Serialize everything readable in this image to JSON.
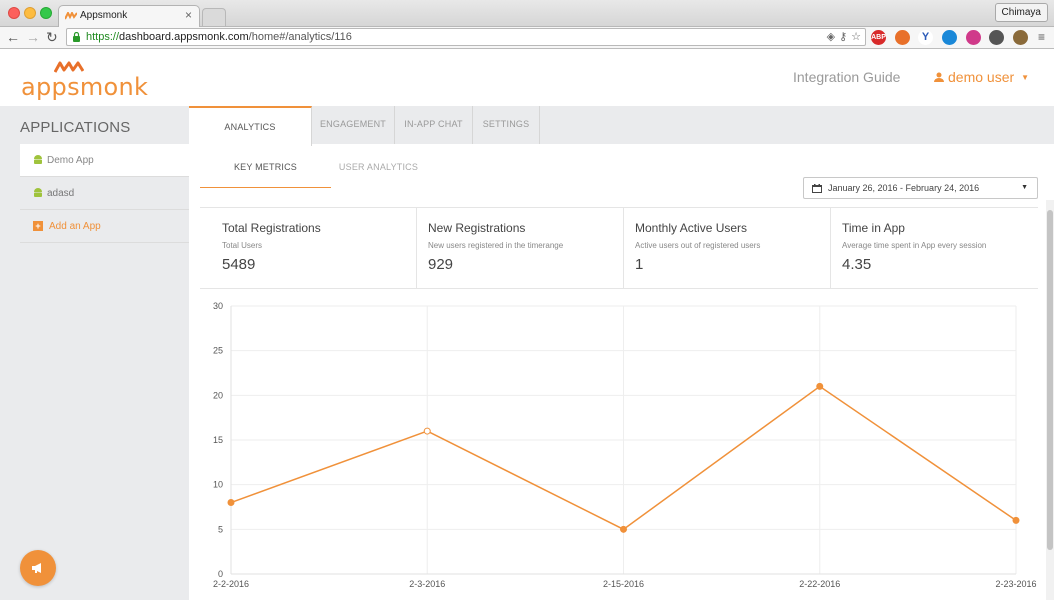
{
  "browser": {
    "tab_title": "Appsmonk",
    "tab_close": "×",
    "profile": "Chimaya",
    "url_scheme": "https://",
    "url_host": "dashboard.appsmonk.com",
    "url_path": "/home#/analytics/116",
    "extension_abp": "ABP"
  },
  "header": {
    "logo": "appsmonk",
    "integration_guide": "Integration Guide",
    "user": "demo user"
  },
  "sidebar": {
    "title": "APPLICATIONS",
    "items": [
      {
        "label": "Demo App",
        "icon": "android-icon",
        "active": true
      },
      {
        "label": "adasd",
        "icon": "android-icon",
        "active": false
      }
    ],
    "add_label": "Add an App",
    "add_icon": "+"
  },
  "tabs": [
    {
      "label": "ANALYTICS",
      "active": true
    },
    {
      "label": "ENGAGEMENT",
      "active": false
    },
    {
      "label": "IN-APP CHAT",
      "active": false
    },
    {
      "label": "SETTINGS",
      "active": false
    }
  ],
  "subtabs": [
    {
      "label": "KEY METRICS",
      "active": true
    },
    {
      "label": "USER ANALYTICS",
      "active": false
    }
  ],
  "date_range": "January 26, 2016 - February 24, 2016",
  "metrics": [
    {
      "title": "Total Registrations",
      "subtitle": "Total Users",
      "value": "5489"
    },
    {
      "title": "New Registrations",
      "subtitle": "New users registered in the timerange",
      "value": "929"
    },
    {
      "title": "Monthly Active Users",
      "subtitle": "Active users out of registered users",
      "value": "1"
    },
    {
      "title": "Time in App",
      "subtitle": "Average time spent in App every session",
      "value": "4.35"
    }
  ],
  "colors": {
    "accent": "#f0913a",
    "sidebar_bg": "#eaebed",
    "grid": "#eeeeee"
  },
  "chart_data": {
    "type": "line",
    "categories": [
      "2-2-2016",
      "2-3-2016",
      "2-15-2016",
      "2-22-2016",
      "2-23-2016"
    ],
    "values": [
      8,
      16,
      5,
      21,
      6
    ],
    "ylim": [
      0,
      30
    ],
    "yticks": [
      0,
      5,
      10,
      15,
      20,
      25,
      30
    ],
    "grid": true,
    "color": "#f0913a"
  }
}
